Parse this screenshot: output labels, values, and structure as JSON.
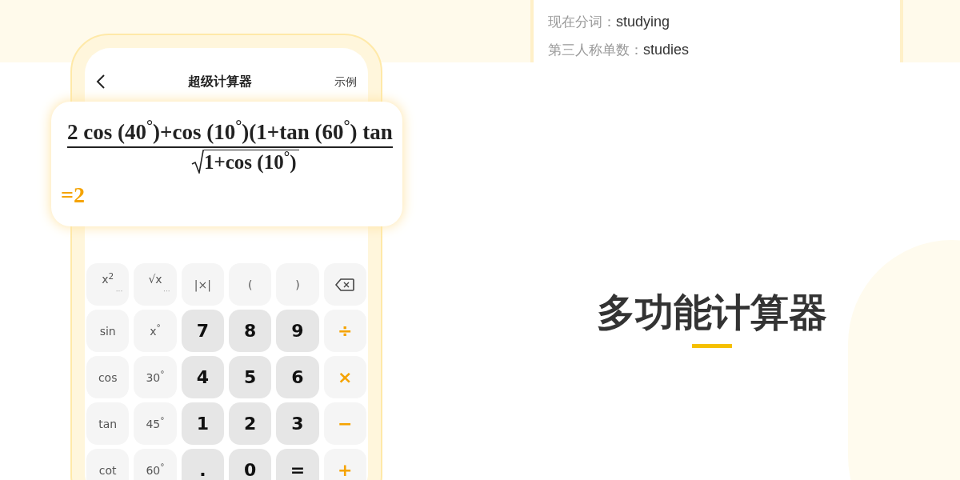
{
  "word_card": {
    "lines": [
      {
        "label": "现在分词：",
        "value": "studying"
      },
      {
        "label": "第三人称单数：",
        "value": "studies"
      }
    ]
  },
  "phone": {
    "title": "超级计算器",
    "action": "示例",
    "formula": {
      "numerator": "2 cos (40$^{°}$)+cos (10$^{°}$)(1+tan (60$^{°}$) tan",
      "denominator": "1+cos (10$^{°}$)",
      "result": "=2"
    },
    "keys": [
      {
        "kind": "fn",
        "label": "x$^{2}$",
        "more": "···"
      },
      {
        "kind": "fn",
        "label": "√x",
        "more": "···"
      },
      {
        "kind": "fn",
        "label": "|×|"
      },
      {
        "kind": "fn",
        "label": "("
      },
      {
        "kind": "fn",
        "label": ")"
      },
      {
        "kind": "backspace"
      },
      {
        "kind": "fn",
        "label": "sin"
      },
      {
        "kind": "fn",
        "label": "x$^{°}$"
      },
      {
        "kind": "num",
        "label": "7"
      },
      {
        "kind": "num",
        "label": "8"
      },
      {
        "kind": "num",
        "label": "9"
      },
      {
        "kind": "op",
        "label": "÷"
      },
      {
        "kind": "fn",
        "label": "cos"
      },
      {
        "kind": "fn",
        "label": "30$^{°}$"
      },
      {
        "kind": "num",
        "label": "4"
      },
      {
        "kind": "num",
        "label": "5"
      },
      {
        "kind": "num",
        "label": "6"
      },
      {
        "kind": "op",
        "label": "×"
      },
      {
        "kind": "fn",
        "label": "tan"
      },
      {
        "kind": "fn",
        "label": "45$^{°}$"
      },
      {
        "kind": "num",
        "label": "1"
      },
      {
        "kind": "num",
        "label": "2"
      },
      {
        "kind": "num",
        "label": "3"
      },
      {
        "kind": "op",
        "label": "−"
      },
      {
        "kind": "fn",
        "label": "cot"
      },
      {
        "kind": "fn",
        "label": "60$^{°}$"
      },
      {
        "kind": "num",
        "label": "."
      },
      {
        "kind": "num",
        "label": "0"
      },
      {
        "kind": "num",
        "label": "="
      },
      {
        "kind": "op",
        "label": "+"
      }
    ]
  },
  "headline": "多功能计算器"
}
